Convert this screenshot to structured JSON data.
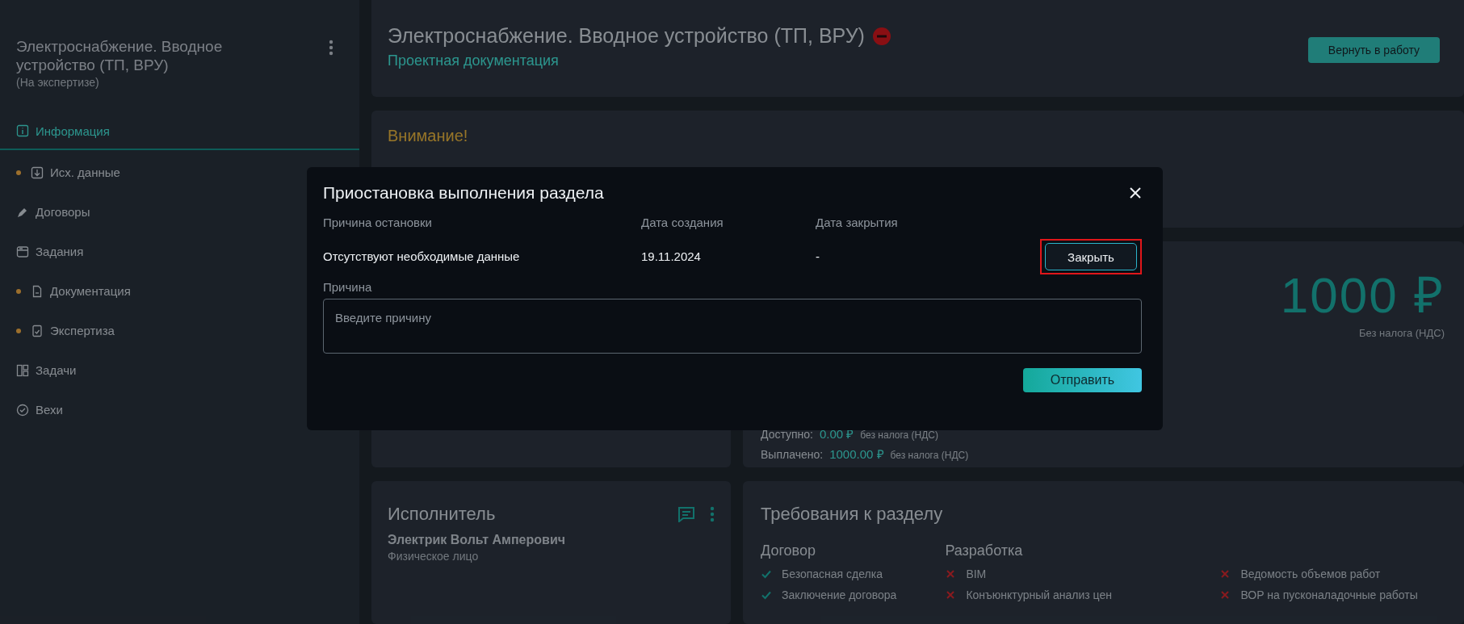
{
  "sidebar": {
    "title": "Электроснабжение. Вводное устройство (ТП, ВРУ)",
    "status": "(На экспертизе)",
    "nav": [
      {
        "label": "Информация",
        "selected": true,
        "marked": false
      },
      {
        "label": "Исх. данные",
        "selected": false,
        "marked": true
      },
      {
        "label": "Договоры",
        "selected": false,
        "marked": false
      },
      {
        "label": "Задания",
        "selected": false,
        "marked": false
      },
      {
        "label": "Документация",
        "selected": false,
        "marked": true
      },
      {
        "label": "Экспертиза",
        "selected": false,
        "marked": true
      },
      {
        "label": "Задачи",
        "selected": false,
        "marked": false
      },
      {
        "label": "Вехи",
        "selected": false,
        "marked": false
      }
    ]
  },
  "header": {
    "title": "Электроснабжение. Вводное устройство (ТП, ВРУ)",
    "subtitle": "Проектная документация",
    "button": "Вернуть в работу"
  },
  "attention": {
    "title": "Внимание!"
  },
  "budget": {
    "amount": "1000 ₽",
    "tax_note": "Без налога (НДС)",
    "lines": [
      {
        "label": "Доступно:",
        "amount": "0.00 ₽",
        "note": "без налога (НДС)"
      },
      {
        "label": "Выплачено:",
        "amount": "1000.00 ₽",
        "note": "без налога (НДС)"
      }
    ]
  },
  "executor": {
    "title": "Исполнитель",
    "name": "Электрик Вольт Амперович",
    "type": "Физическое лицо"
  },
  "requirements": {
    "title": "Требования к разделу",
    "groups": [
      {
        "title": "Договор",
        "items": [
          {
            "label": "Безопасная сделка",
            "done": true
          },
          {
            "label": "Заключение договора",
            "done": true
          }
        ]
      },
      {
        "title": "Разработка",
        "items": [
          {
            "label": "BIM",
            "done": false
          },
          {
            "label": "Ведомость объемов работ",
            "done": false
          },
          {
            "label": "Конъюнктурный анализ цен",
            "done": false
          },
          {
            "label": "ВОР на пусконаладочные работы",
            "done": false
          }
        ]
      }
    ]
  },
  "modal": {
    "title": "Приостановка выполнения раздела",
    "columns": [
      "Причина остановки",
      "Дата создания",
      "Дата закрытия"
    ],
    "rows": [
      {
        "reason": "Отсутствуют необходимые данные",
        "created": "19.11.2024",
        "closed": "-",
        "action": "Закрыть",
        "highlighted": true
      }
    ],
    "field_label": "Причина",
    "placeholder": "Введите причину",
    "submit": "Отправить"
  }
}
